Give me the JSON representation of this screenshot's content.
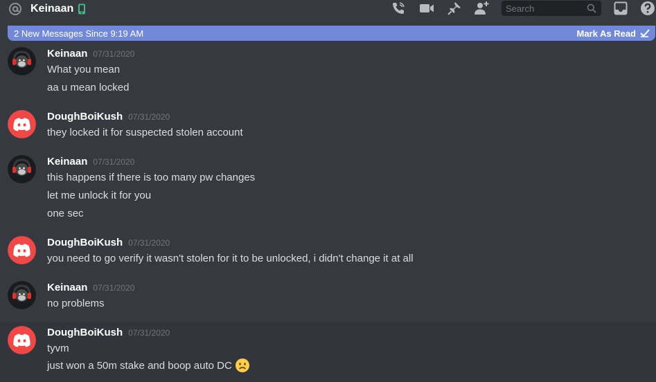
{
  "header": {
    "channel_name": "Keinaan",
    "search_placeholder": "Search",
    "icons": [
      "at-icon",
      "mobile-phone-icon",
      "call-icon",
      "video-icon",
      "pin-icon",
      "add-friend-icon",
      "search-icon",
      "inbox-icon",
      "help-icon"
    ]
  },
  "new_messages_bar": {
    "text": "2 New Messages Since 9:19 AM",
    "mark_read": "Mark As Read"
  },
  "colors": {
    "background": "#36393f",
    "accent": "#7289da",
    "discord_red": "#f04747",
    "mobile_green": "#43b581"
  },
  "messages": [
    {
      "author": "Keinaan",
      "timestamp": "07/31/2020",
      "avatar": "gorilla-headphones-avatar",
      "lines": [
        "What you mean",
        "aa u mean locked"
      ]
    },
    {
      "author": "DoughBoiKush",
      "timestamp": "07/31/2020",
      "avatar": "discord-default-avatar",
      "lines": [
        "they locked it for suspected stolen account"
      ]
    },
    {
      "author": "Keinaan",
      "timestamp": "07/31/2020",
      "avatar": "gorilla-headphones-avatar",
      "lines": [
        "this happens if there is too many pw changes",
        "let me unlock it for you",
        "one sec"
      ]
    },
    {
      "author": "DoughBoiKush",
      "timestamp": "07/31/2020",
      "avatar": "discord-default-avatar",
      "lines": [
        "you need to go verify it wasn't stolen for it to be unlocked, i didn't change it at all"
      ]
    },
    {
      "author": "Keinaan",
      "timestamp": "07/31/2020",
      "avatar": "gorilla-headphones-avatar",
      "lines": [
        "no problems"
      ]
    },
    {
      "author": "DoughBoiKush",
      "timestamp": "07/31/2020",
      "avatar": "discord-default-avatar",
      "lines": [
        "tyvm",
        "just won a 50m stake and boop auto DC"
      ],
      "last_line_emoji": "frowning-face-emoji"
    }
  ]
}
